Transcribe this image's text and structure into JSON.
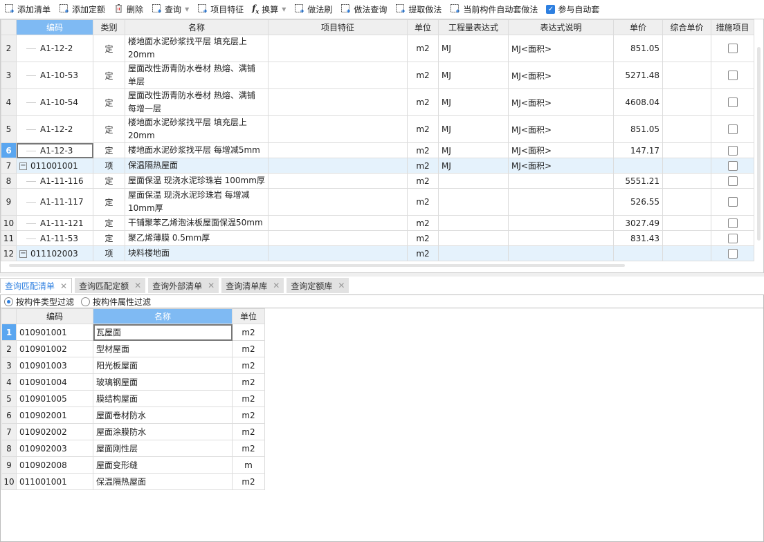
{
  "toolbar": {
    "items": [
      {
        "label": "添加清单",
        "icon": "add-list-icon"
      },
      {
        "label": "添加定额",
        "icon": "add-quota-icon"
      },
      {
        "label": "删除",
        "icon": "delete-icon"
      },
      {
        "label": "查询",
        "icon": "query-icon",
        "dropdown": true
      },
      {
        "label": "项目特征",
        "icon": "feature-icon"
      },
      {
        "label": "换算",
        "icon": "fx-icon",
        "dropdown": true
      },
      {
        "label": "做法刷",
        "icon": "brush-icon"
      },
      {
        "label": "做法查询",
        "icon": "method-query-icon"
      },
      {
        "label": "提取做法",
        "icon": "extract-icon"
      },
      {
        "label": "当前构件自动套做法",
        "icon": "auto-apply-icon"
      }
    ],
    "auto_checkbox": {
      "label": "参与自动套",
      "checked": true
    }
  },
  "main_table": {
    "headers": [
      "",
      "编码",
      "类别",
      "名称",
      "项目特征",
      "单位",
      "工程量表达式",
      "表达式说明",
      "单价",
      "综合单价",
      "措施项目"
    ],
    "rows": [
      {
        "n": "2",
        "code": "A1-12-2",
        "type": "定",
        "name": "楼地面水泥砂浆找平层 填充层上20mm",
        "unit": "m2",
        "expr": "MJ",
        "desc": "MJ<面积>",
        "price": "851.05",
        "tall": true
      },
      {
        "n": "3",
        "code": "A1-10-53",
        "type": "定",
        "name": "屋面改性沥青防水卷材 热熔、满铺 单层",
        "unit": "m2",
        "expr": "MJ",
        "desc": "MJ<面积>",
        "price": "5271.48",
        "tall": true
      },
      {
        "n": "4",
        "code": "A1-10-54",
        "type": "定",
        "name": "屋面改性沥青防水卷材 热熔、满铺 每增一层",
        "unit": "m2",
        "expr": "MJ",
        "desc": "MJ<面积>",
        "price": "4608.04",
        "tall": true
      },
      {
        "n": "5",
        "code": "A1-12-2",
        "type": "定",
        "name": "楼地面水泥砂浆找平层 填充层上20mm",
        "unit": "m2",
        "expr": "MJ",
        "desc": "MJ<面积>",
        "price": "851.05",
        "tall": true
      },
      {
        "n": "6",
        "code": "A1-12-3",
        "type": "定",
        "name": "楼地面水泥砂浆找平层 每增减5mm",
        "unit": "m2",
        "expr": "MJ",
        "desc": "MJ<面积>",
        "price": "147.17",
        "current": true
      },
      {
        "n": "7",
        "code": "011001001",
        "type": "项",
        "name": "保温隔热屋面",
        "unit": "m2",
        "expr": "MJ",
        "desc": "MJ<面积>",
        "price": "",
        "group": true
      },
      {
        "n": "8",
        "code": "A1-11-116",
        "type": "定",
        "name": "屋面保温 现浇水泥珍珠岩 100mm厚",
        "unit": "m2",
        "expr": "",
        "desc": "",
        "price": "5551.21"
      },
      {
        "n": "9",
        "code": "A1-11-117",
        "type": "定",
        "name": "屋面保温 现浇水泥珍珠岩 每增减10mm厚",
        "unit": "m2",
        "expr": "",
        "desc": "",
        "price": "526.55",
        "tall": true
      },
      {
        "n": "10",
        "code": "A1-11-121",
        "type": "定",
        "name": "干铺聚苯乙烯泡沫板屋面保温50mm",
        "unit": "m2",
        "expr": "",
        "desc": "",
        "price": "3027.49"
      },
      {
        "n": "11",
        "code": "A1-11-53",
        "type": "定",
        "name": "聚乙烯薄膜 0.5mm厚",
        "unit": "m2",
        "expr": "",
        "desc": "",
        "price": "831.43"
      },
      {
        "n": "12",
        "code": "011102003",
        "type": "项",
        "name": "块料楼地面",
        "unit": "m2",
        "expr": "",
        "desc": "",
        "price": "",
        "group": true
      }
    ]
  },
  "bottom_tabs": [
    {
      "label": "查询匹配清单",
      "active": true
    },
    {
      "label": "查询匹配定额"
    },
    {
      "label": "查询外部清单"
    },
    {
      "label": "查询清单库"
    },
    {
      "label": "查询定额库"
    }
  ],
  "filter": {
    "options": [
      {
        "label": "按构件类型过滤",
        "selected": true
      },
      {
        "label": "按构件属性过滤",
        "selected": false
      }
    ]
  },
  "lookup_table": {
    "headers": [
      "",
      "编码",
      "名称",
      "单位"
    ],
    "rows": [
      [
        "1",
        "010901001",
        "瓦屋面",
        "m2"
      ],
      [
        "2",
        "010901002",
        "型材屋面",
        "m2"
      ],
      [
        "3",
        "010901003",
        "阳光板屋面",
        "m2"
      ],
      [
        "4",
        "010901004",
        "玻璃钢屋面",
        "m2"
      ],
      [
        "5",
        "010901005",
        "膜结构屋面",
        "m2"
      ],
      [
        "6",
        "010902001",
        "屋面卷材防水",
        "m2"
      ],
      [
        "7",
        "010902002",
        "屋面涂膜防水",
        "m2"
      ],
      [
        "8",
        "010902003",
        "屋面刚性层",
        "m2"
      ],
      [
        "9",
        "010902008",
        "屋面变形缝",
        "m"
      ],
      [
        "10",
        "011001001",
        "保温隔热屋面",
        "m2"
      ]
    ]
  },
  "colors": {
    "accent": "#2d7fe0",
    "header_selected": "#7fbaf3",
    "group_row": "#e5f2fc"
  }
}
